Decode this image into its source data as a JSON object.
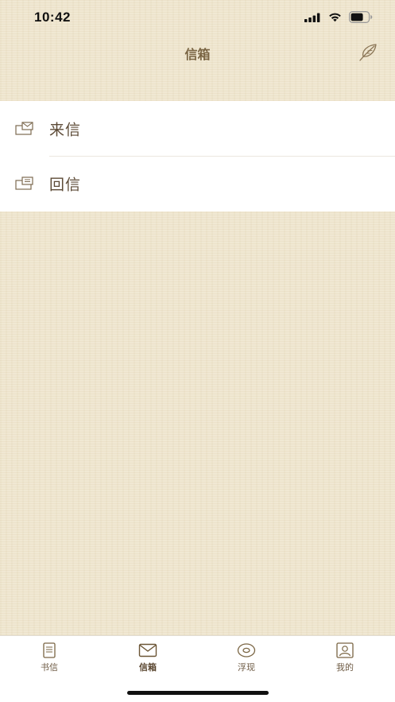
{
  "status_bar": {
    "time": "10:42",
    "icons": [
      "cellular-signal-icon",
      "wifi-icon",
      "battery-icon"
    ]
  },
  "nav": {
    "title": "信箱",
    "compose_icon": "feather-quill-icon"
  },
  "mail_items": [
    {
      "label": "来信",
      "icon": "inbox-envelope-icon"
    },
    {
      "label": "回信",
      "icon": "reply-letter-icon"
    }
  ],
  "tabs": [
    {
      "label": "书信",
      "icon": "letter-doc-icon",
      "active": false
    },
    {
      "label": "信箱",
      "icon": "envelope-icon",
      "active": true
    },
    {
      "label": "浮现",
      "icon": "eye-icon",
      "active": false
    },
    {
      "label": "我的",
      "icon": "profile-icon",
      "active": false
    }
  ],
  "colors": {
    "paper_background": "#efe6cf",
    "accent_brown": "#7a6543",
    "text_brown": "#5c4a36",
    "list_background": "#ffffff"
  }
}
